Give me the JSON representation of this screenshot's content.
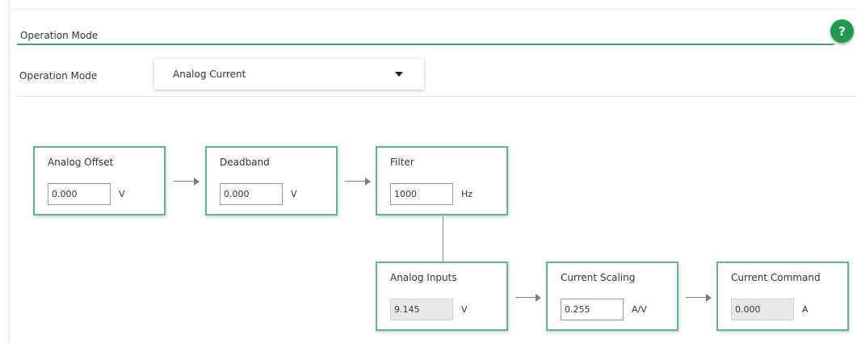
{
  "section": {
    "title": "Operation Mode"
  },
  "help": {
    "label": "?"
  },
  "operation_mode": {
    "label": "Operation Mode",
    "selected": "Analog Current"
  },
  "blocks": {
    "analog_offset": {
      "title": "Analog Offset",
      "value": "0.000",
      "unit": "V"
    },
    "deadband": {
      "title": "Deadband",
      "value": "0.000",
      "unit": "V"
    },
    "filter": {
      "title": "Filter",
      "value": "1000",
      "unit": "Hz"
    },
    "analog_inputs": {
      "title": "Analog Inputs",
      "value": "9.145",
      "unit": "V"
    },
    "current_scaling": {
      "title": "Current Scaling",
      "value": "0.255",
      "unit": "A/V"
    },
    "current_command": {
      "title": "Current Command",
      "value": "0.000",
      "unit": "A"
    }
  },
  "colors": {
    "accent": "#3da57a",
    "help_button": "#1f9a4d",
    "block_border": "#5fb39a"
  }
}
